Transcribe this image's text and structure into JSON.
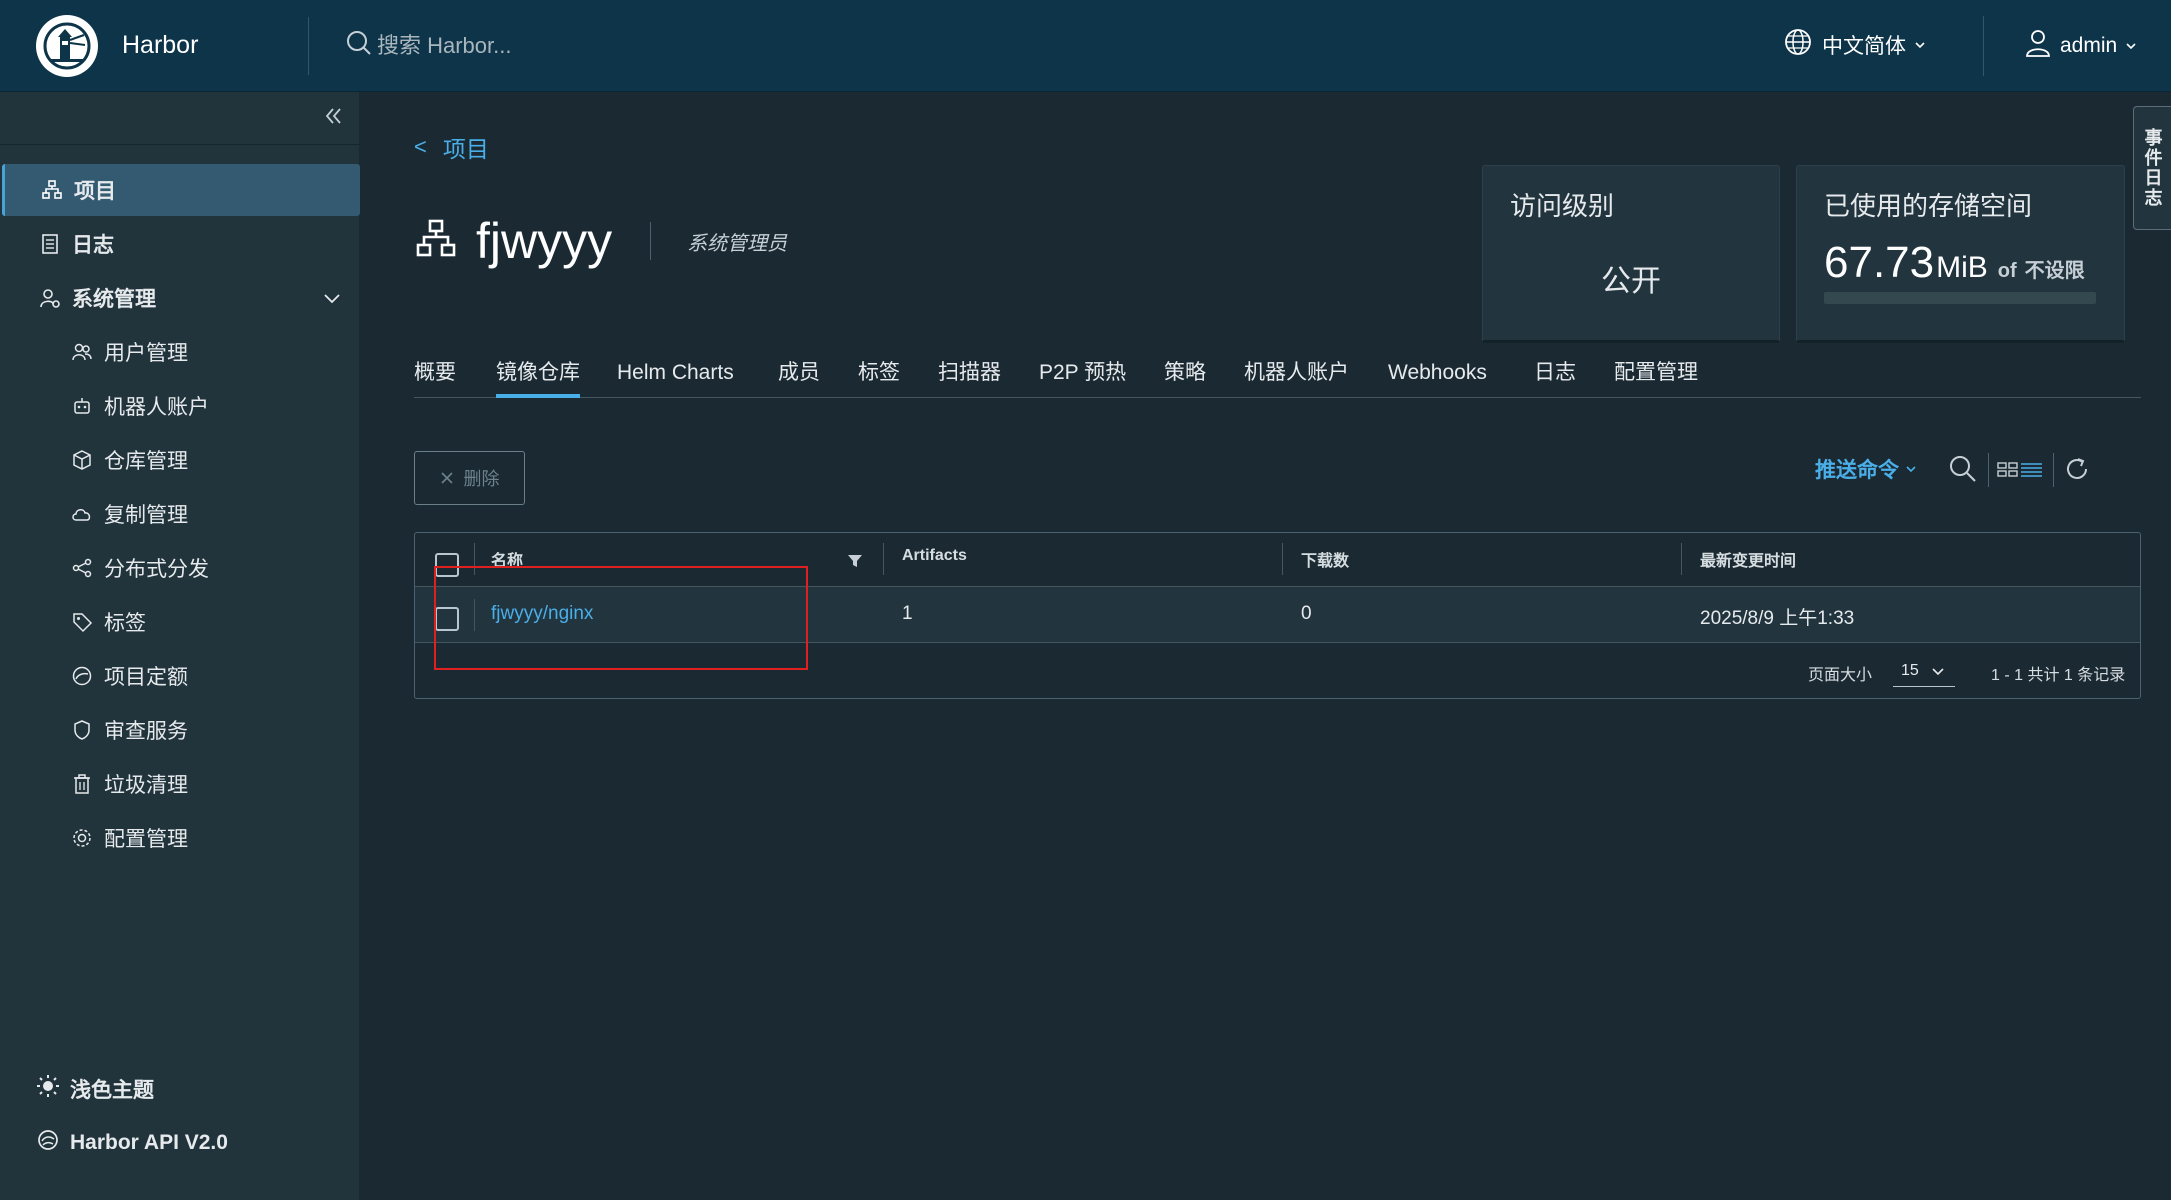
{
  "header": {
    "brand": "Harbor",
    "search_placeholder": "搜索 Harbor...",
    "language": "中文简体",
    "user": "admin"
  },
  "sidebar": {
    "items": [
      {
        "label": "项目",
        "icon": "project-icon",
        "active": true
      },
      {
        "label": "日志",
        "icon": "log-icon"
      },
      {
        "label": "系统管理",
        "icon": "admin-icon",
        "expanded": true
      }
    ],
    "sub_items": [
      {
        "label": "用户管理",
        "icon": "users-icon"
      },
      {
        "label": "机器人账户",
        "icon": "robot-icon"
      },
      {
        "label": "仓库管理",
        "icon": "cube-icon"
      },
      {
        "label": "复制管理",
        "icon": "cloud-sync-icon"
      },
      {
        "label": "分布式分发",
        "icon": "share-icon"
      },
      {
        "label": "标签",
        "icon": "tag-icon"
      },
      {
        "label": "项目定额",
        "icon": "quota-icon"
      },
      {
        "label": "审查服务",
        "icon": "shield-icon"
      },
      {
        "label": "垃圾清理",
        "icon": "trash-icon"
      },
      {
        "label": "配置管理",
        "icon": "gear-icon"
      }
    ],
    "theme": "浅色主题",
    "api": "Harbor API V2.0"
  },
  "breadcrumb": {
    "back": "<",
    "label": "项目"
  },
  "project": {
    "name": "fjwyyy",
    "role": "系统管理员"
  },
  "cards": {
    "access": {
      "title": "访问级别",
      "value": "公开"
    },
    "storage": {
      "title": "已使用的存储空间",
      "value": "67.73",
      "unit": "MiB",
      "of": "of",
      "limit": "不设限",
      "usage_fraction": 0
    }
  },
  "tabs": [
    {
      "label": "概要"
    },
    {
      "label": "镜像仓库",
      "active": true
    },
    {
      "label": "Helm Charts"
    },
    {
      "label": "成员"
    },
    {
      "label": "标签"
    },
    {
      "label": "扫描器"
    },
    {
      "label": "P2P 预热"
    },
    {
      "label": "策略"
    },
    {
      "label": "机器人账户"
    },
    {
      "label": "Webhooks"
    },
    {
      "label": "日志"
    },
    {
      "label": "配置管理"
    }
  ],
  "toolbar": {
    "delete": "删除",
    "push_command": "推送命令"
  },
  "table": {
    "columns": [
      "名称",
      "Artifacts",
      "下载数",
      "最新变更时间"
    ],
    "rows": [
      {
        "name": "fjwyyy/nginx",
        "artifacts": "1",
        "downloads": "0",
        "updated": "2025/8/9 上午1:33"
      }
    ],
    "page_size_label": "页面大小",
    "page_size": "15",
    "page_info": "1 - 1 共计 1 条记录"
  },
  "event_log": "事件日志",
  "colors": {
    "accent": "#4aaee8",
    "header": "#0e3449",
    "sidebar": "#21333b",
    "highlight": "#e02020"
  }
}
